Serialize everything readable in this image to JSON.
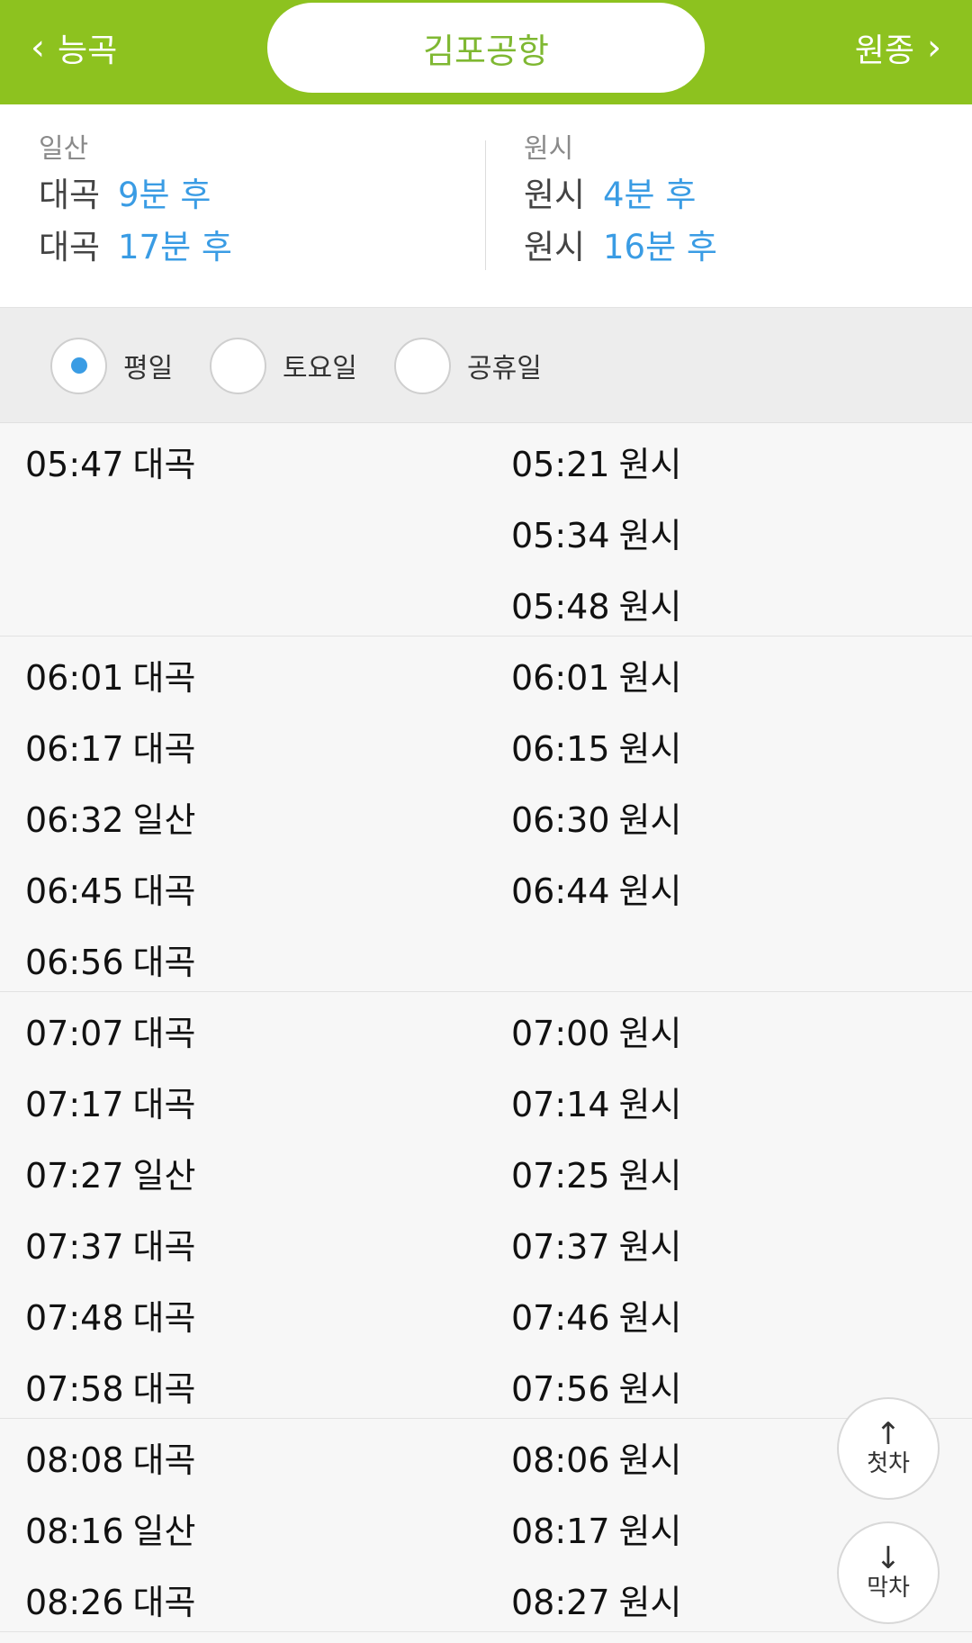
{
  "header": {
    "prev_station": "능곡",
    "current_station": "김포공항",
    "next_station": "원종"
  },
  "arrivals": {
    "left": {
      "direction": "일산",
      "trains": [
        {
          "dest": "대곡",
          "time": "9분 후"
        },
        {
          "dest": "대곡",
          "time": "17분 후"
        }
      ]
    },
    "right": {
      "direction": "원시",
      "trains": [
        {
          "dest": "원시",
          "time": "4분 후"
        },
        {
          "dest": "원시",
          "time": "16분 후"
        }
      ]
    }
  },
  "day_options": [
    {
      "label": "평일",
      "selected": true
    },
    {
      "label": "토요일",
      "selected": false
    },
    {
      "label": "공휴일",
      "selected": false
    }
  ],
  "timetable": [
    {
      "left": [
        {
          "time": "05:47",
          "dest": "대곡"
        }
      ],
      "right": [
        {
          "time": "05:21",
          "dest": "원시"
        },
        {
          "time": "05:34",
          "dest": "원시"
        },
        {
          "time": "05:48",
          "dest": "원시"
        }
      ]
    },
    {
      "left": [
        {
          "time": "06:01",
          "dest": "대곡"
        },
        {
          "time": "06:17",
          "dest": "대곡"
        },
        {
          "time": "06:32",
          "dest": "일산"
        },
        {
          "time": "06:45",
          "dest": "대곡"
        },
        {
          "time": "06:56",
          "dest": "대곡"
        }
      ],
      "right": [
        {
          "time": "06:01",
          "dest": "원시"
        },
        {
          "time": "06:15",
          "dest": "원시"
        },
        {
          "time": "06:30",
          "dest": "원시"
        },
        {
          "time": "06:44",
          "dest": "원시"
        }
      ]
    },
    {
      "left": [
        {
          "time": "07:07",
          "dest": "대곡"
        },
        {
          "time": "07:17",
          "dest": "대곡"
        },
        {
          "time": "07:27",
          "dest": "일산"
        },
        {
          "time": "07:37",
          "dest": "대곡"
        },
        {
          "time": "07:48",
          "dest": "대곡"
        },
        {
          "time": "07:58",
          "dest": "대곡"
        }
      ],
      "right": [
        {
          "time": "07:00",
          "dest": "원시"
        },
        {
          "time": "07:14",
          "dest": "원시"
        },
        {
          "time": "07:25",
          "dest": "원시"
        },
        {
          "time": "07:37",
          "dest": "원시"
        },
        {
          "time": "07:46",
          "dest": "원시"
        },
        {
          "time": "07:56",
          "dest": "원시"
        }
      ]
    },
    {
      "left": [
        {
          "time": "08:08",
          "dest": "대곡"
        },
        {
          "time": "08:16",
          "dest": "일산"
        },
        {
          "time": "08:26",
          "dest": "대곡"
        }
      ],
      "right": [
        {
          "time": "08:06",
          "dest": "원시"
        },
        {
          "time": "08:17",
          "dest": "원시"
        },
        {
          "time": "08:27",
          "dest": "원시"
        }
      ]
    }
  ],
  "buttons": {
    "first_train": {
      "icon": "arrow-up-icon",
      "label": "첫차"
    },
    "last_train": {
      "icon": "arrow-down-icon",
      "label": "막차"
    }
  }
}
